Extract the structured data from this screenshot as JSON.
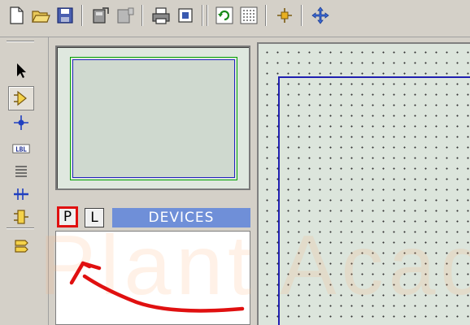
{
  "toolbar": {
    "buttons": [
      "new-file",
      "open-folder",
      "save",
      "import",
      "export",
      "print",
      "page-setup",
      "refresh",
      "grid",
      "origin",
      "pan"
    ]
  },
  "left_toolbar": {
    "tools": [
      "selection",
      "component",
      "junction-dot",
      "wire-label",
      "text-script",
      "buses",
      "subcircuit",
      "terminals"
    ],
    "active_tool": "component",
    "label_tool_text": "LBL"
  },
  "devices_panel": {
    "pick_tab": "P",
    "library_tab": "L",
    "title": "DEVICES"
  },
  "watermark": "Plant Acad",
  "colors": {
    "devices_header": "#6f8fd8",
    "annotation": "#e01010",
    "sheet_border": "#2020b0",
    "overview_frame": "#00a000"
  }
}
